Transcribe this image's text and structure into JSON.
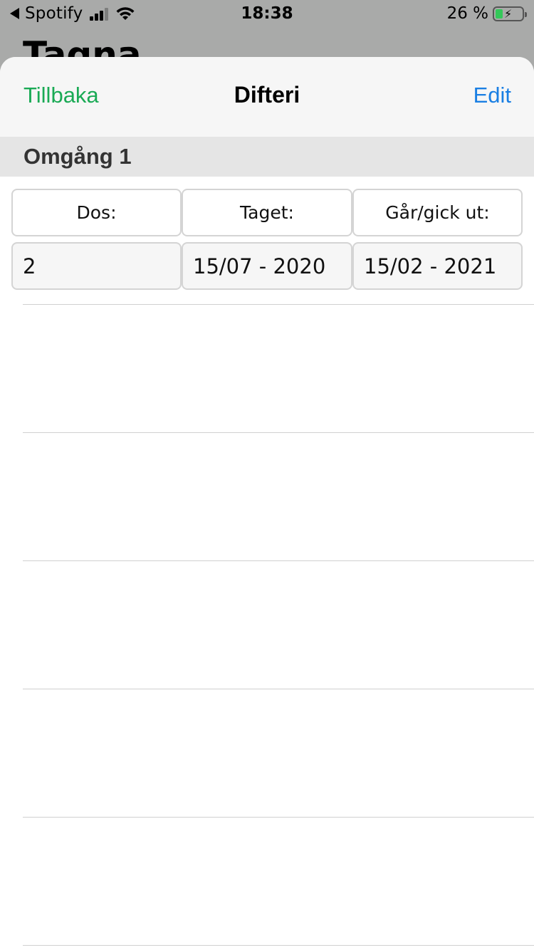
{
  "status_bar": {
    "carrier": "Spotify",
    "time": "18:38",
    "battery_percent": "26 %",
    "signal_bars": 3,
    "charging": true
  },
  "background": {
    "title_peek": "Tagna"
  },
  "nav": {
    "back_label": "Tillbaka",
    "title": "Difteri",
    "edit_label": "Edit",
    "colors": {
      "back": "#1aaa55",
      "edit": "#1a7fe3"
    }
  },
  "section": {
    "title": "Omgång 1"
  },
  "table": {
    "headers": [
      "Dos:",
      "Taget:",
      "Går/gick ut:"
    ],
    "rows": [
      [
        "2",
        "15/07 - 2020",
        "15/02 - 2021"
      ]
    ]
  }
}
